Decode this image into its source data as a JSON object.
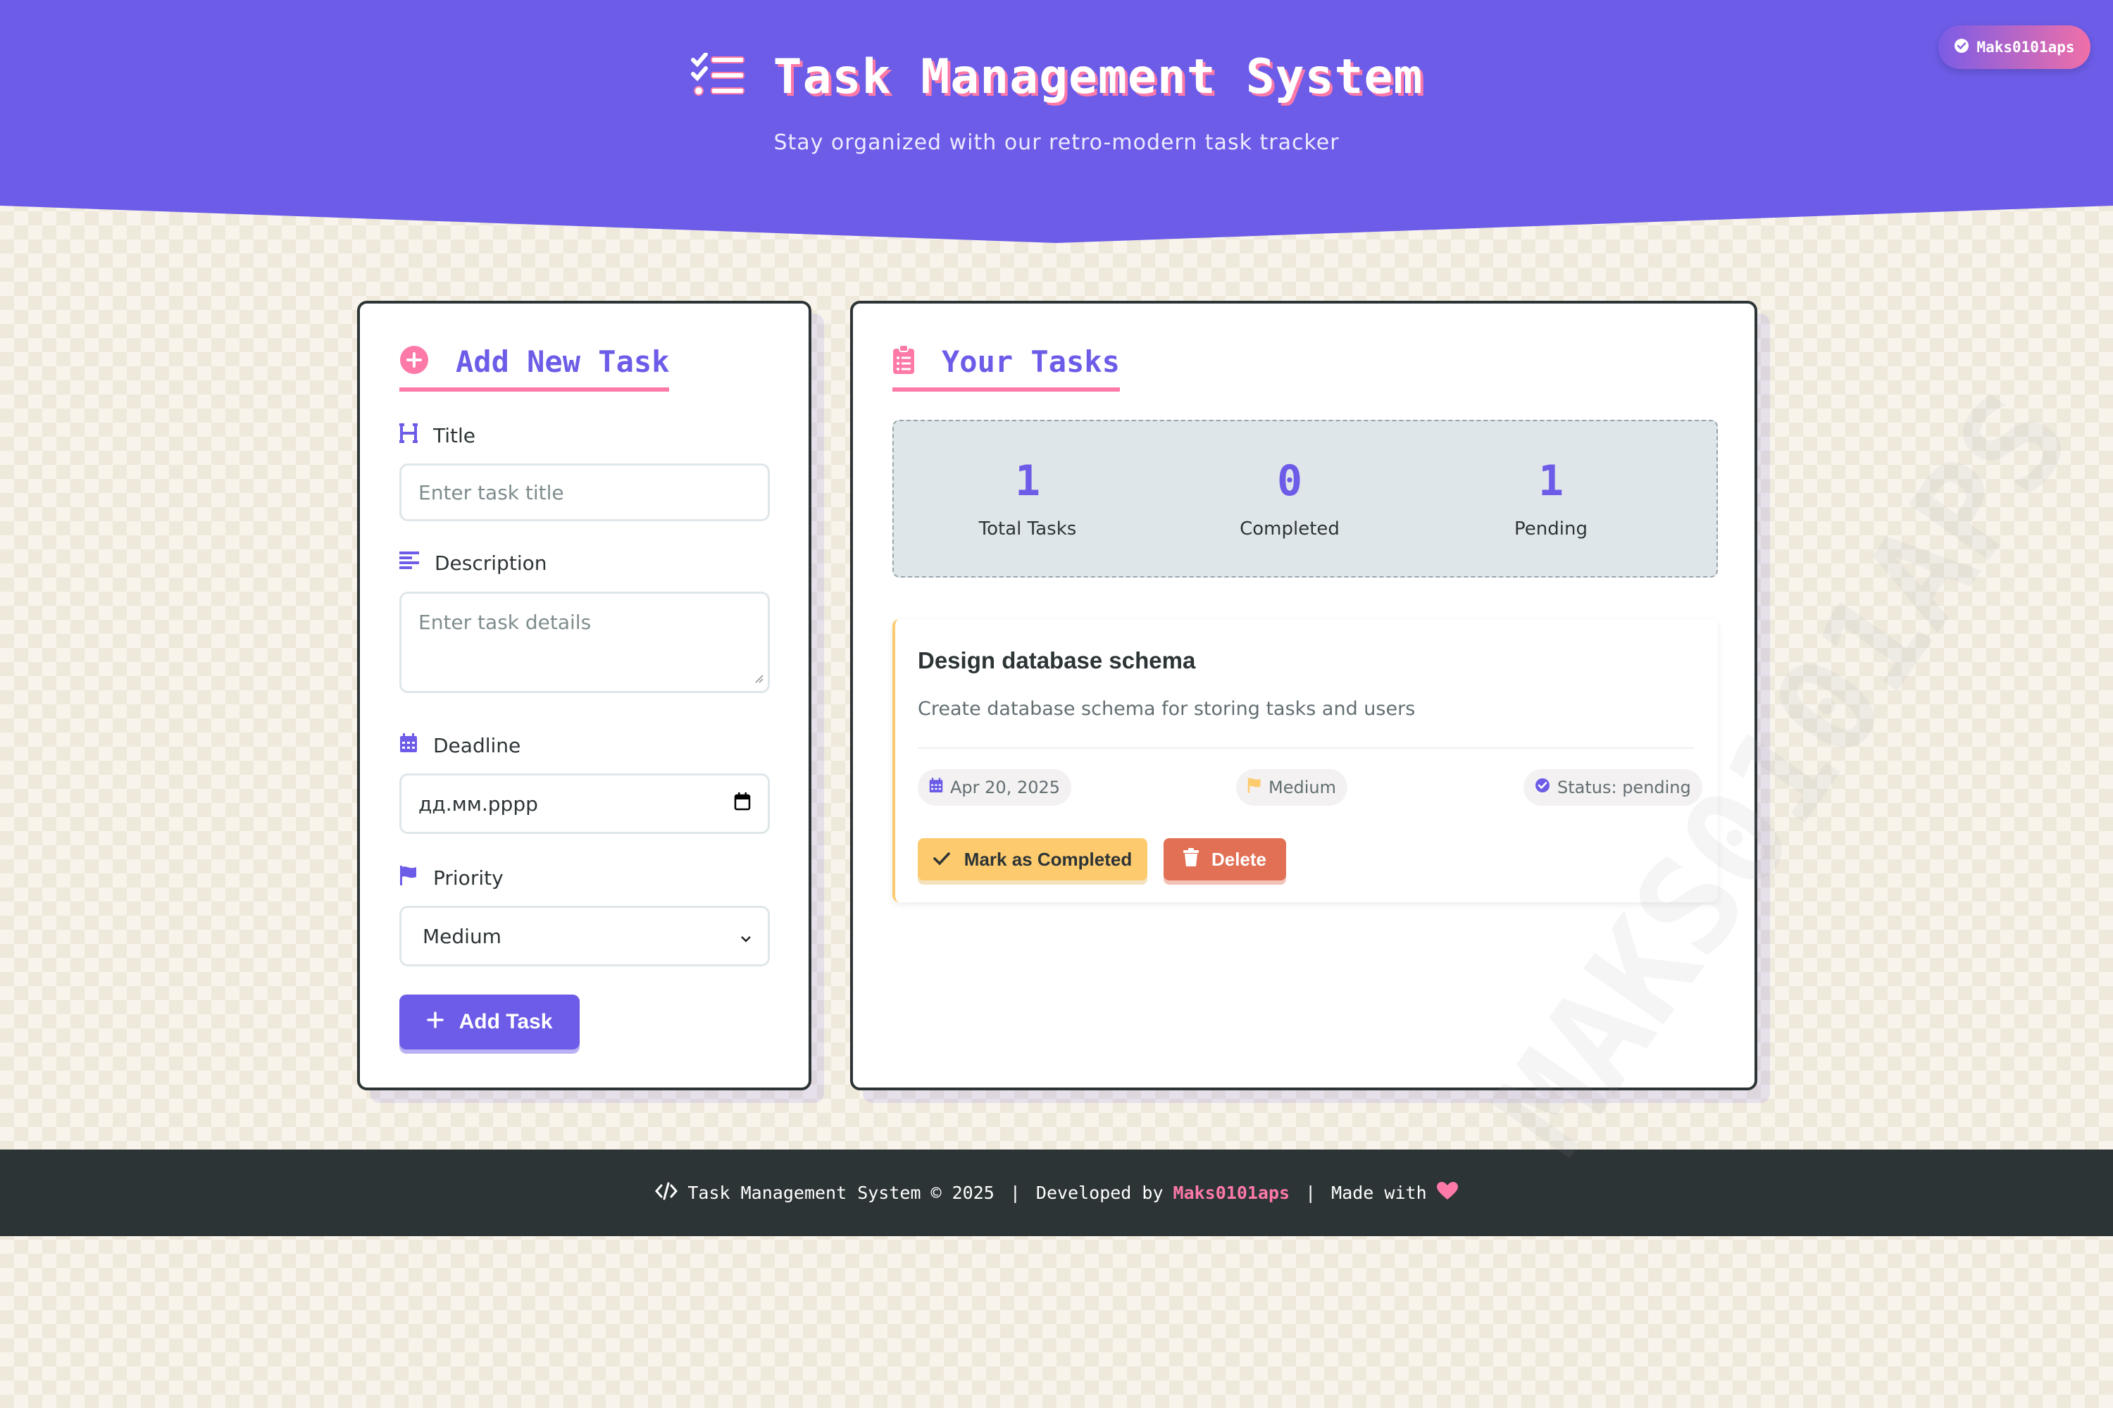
{
  "header": {
    "title": "Task Management System",
    "subtitle": "Stay organized with our retro-modern task tracker",
    "user_badge": "Maks0101aps"
  },
  "add_task": {
    "heading": "Add New Task",
    "title_label": "Title",
    "title_placeholder": "Enter task title",
    "description_label": "Description",
    "description_placeholder": "Enter task details",
    "deadline_label": "Deadline",
    "deadline_value": "дд.мм.рррр",
    "priority_label": "Priority",
    "priority_value": "Medium",
    "submit_label": "Add Task"
  },
  "tasks_panel": {
    "heading": "Your Tasks",
    "stats": [
      {
        "value": "1",
        "label": "Total Tasks"
      },
      {
        "value": "0",
        "label": "Completed"
      },
      {
        "value": "1",
        "label": "Pending"
      }
    ],
    "tasks": [
      {
        "title": "Design database schema",
        "description": "Create database schema for storing tasks and users",
        "deadline": "Apr 20, 2025",
        "priority": "Medium",
        "status": "Status: pending",
        "complete_label": "Mark as Completed",
        "delete_label": "Delete"
      }
    ]
  },
  "footer": {
    "app_name": "Task Management System",
    "copyright": "© 2025",
    "developed_by": "Developed by",
    "author": "Maks0101aps",
    "made_with": "Made with"
  },
  "watermark": "MAKS0101APS",
  "colors": {
    "primary": "#6c5ce7",
    "accent_pink": "#fd79a8",
    "warning_yellow": "#fdcb6e",
    "danger": "#e17055",
    "dark": "#2d3436"
  },
  "icons": [
    "tasks-icon",
    "check-circle-icon",
    "plus-circle-icon",
    "heading-icon",
    "align-left-icon",
    "calendar-icon",
    "flag-icon",
    "plus-icon",
    "clipboard-list-icon",
    "check-icon",
    "trash-icon",
    "code-icon",
    "heart-icon",
    "chevron-down-icon"
  ]
}
